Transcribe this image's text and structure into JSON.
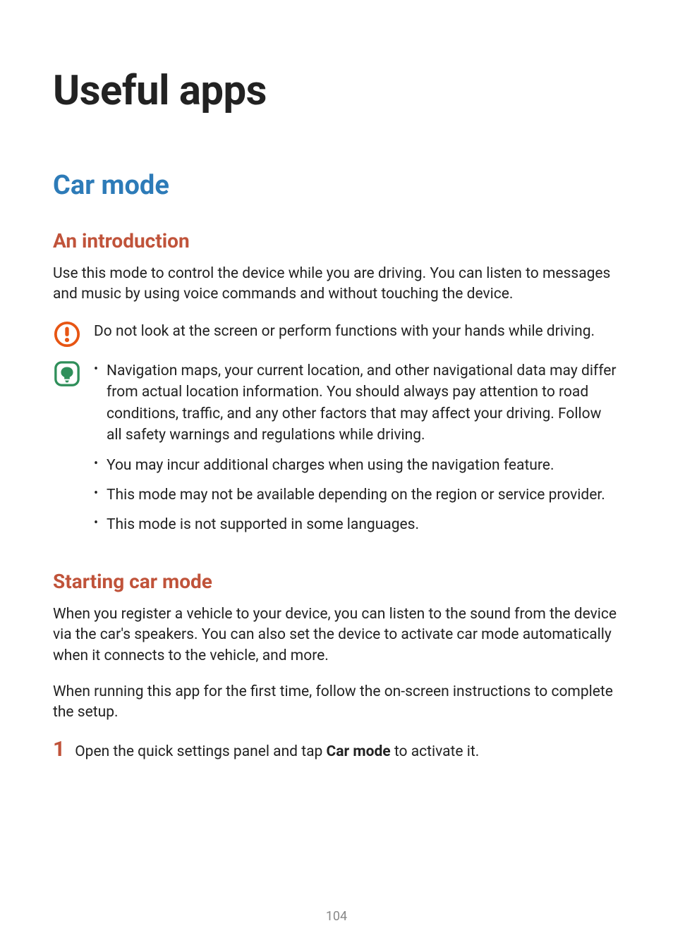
{
  "page_title": "Useful apps",
  "section_title": "Car mode",
  "intro": {
    "heading": "An introduction",
    "paragraph": "Use this mode to control the device while you are driving. You can listen to messages and music by using voice commands and without touching the device."
  },
  "warning_text": "Do not look at the screen or perform functions with your hands while driving.",
  "note_bullets": [
    "Navigation maps, your current location, and other navigational data may differ from actual location information. You should always pay attention to road conditions, traffic, and any other factors that may affect your driving. Follow all safety warnings and regulations while driving.",
    "You may incur additional charges when using the navigation feature.",
    "This mode may not be available depending on the region or service provider.",
    "This mode is not supported in some languages."
  ],
  "starting": {
    "heading": "Starting car mode",
    "p1": "When you register a vehicle to your device, you can listen to the sound from the device via the car's speakers. You can also set the device to activate car mode automatically when it connects to the vehicle, and more.",
    "p2": "When running this app for the first time, follow the on-screen instructions to complete the setup."
  },
  "step1": {
    "number": "1",
    "prefix": "Open the quick settings panel and tap ",
    "bold": "Car mode",
    "suffix": " to activate it."
  },
  "page_number": "104"
}
